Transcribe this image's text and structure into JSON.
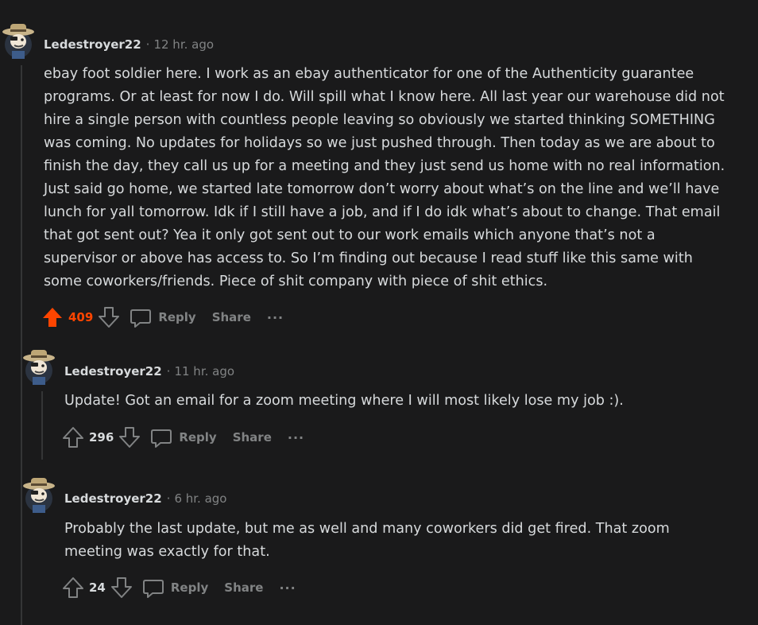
{
  "comments": [
    {
      "author": "Ledestroyer22",
      "separator": "·",
      "time": "12 hr. ago",
      "body_lines": [
        "ebay foot soldier here. I work as an ebay authenticator for one of the Authenticity guarantee",
        "programs. Or at least for now I do. Will spill what I know here. All last year our warehouse did not",
        "hire a single person with countless people leaving so obviously we started thinking SOMETHING",
        "was coming. No updates for holidays so we just pushed through. Then today as we are about to",
        "finish the day, they call us up for a meeting and they just send us home with no real information.",
        "Just said go home, we started late tomorrow don’t worry about what’s on the line and we’ll have",
        "lunch for yall tomorrow. Idk if I still have a job, and if I do idk what’s about to change. That email",
        "that got sent out? Yea it only got sent out to our work emails which anyone that’s not a",
        "supervisor or above has access to. So I’m finding out because I read stuff like this same with",
        "some coworkers/friends. Piece of shit company with piece of shit ethics."
      ],
      "score": "409",
      "upvoted": true,
      "reply_label": "Reply",
      "share_label": "Share",
      "more_label": "···"
    },
    {
      "author": "Ledestroyer22",
      "separator": "·",
      "time": "11 hr. ago",
      "body_lines": [
        "Update! Got an email for a zoom meeting where I will most likely lose my job :)."
      ],
      "score": "296",
      "upvoted": false,
      "reply_label": "Reply",
      "share_label": "Share",
      "more_label": "···"
    },
    {
      "author": "Ledestroyer22",
      "separator": "·",
      "time": "6 hr. ago",
      "body_lines": [
        "Probably the last update, but me as well and many coworkers did get fired. That zoom",
        "meeting was exactly for that."
      ],
      "score": "24",
      "upvoted": false,
      "reply_label": "Reply",
      "share_label": "Share",
      "more_label": "···"
    }
  ],
  "colors": {
    "background": "#1a1a1b",
    "text": "#d7dadc",
    "muted": "#818384",
    "upvote": "#ff4500",
    "thread_line": "#343536"
  }
}
